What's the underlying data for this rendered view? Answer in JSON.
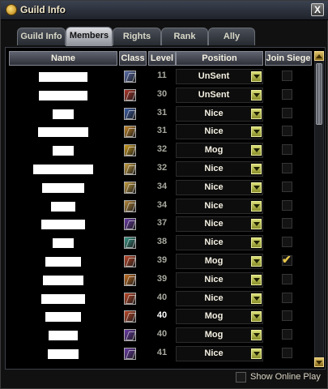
{
  "window": {
    "title": "Guild Info",
    "close_label": "X"
  },
  "tabs": [
    {
      "label": "Guild Info",
      "active": false
    },
    {
      "label": "Members",
      "active": true
    },
    {
      "label": "Rights",
      "active": false
    },
    {
      "label": "Rank",
      "active": false
    },
    {
      "label": "Ally",
      "active": false
    }
  ],
  "columns": {
    "name": "Name",
    "class": "Class",
    "level": "Level",
    "position": "Position",
    "join_siege": "Join Siege"
  },
  "members": [
    {
      "level": "11",
      "position": "UnSent",
      "class_icon": "mage-icon",
      "icon_color": "#5a6fb0",
      "join_siege": false,
      "level_highlight": false
    },
    {
      "level": "30",
      "position": "UnSent",
      "class_icon": "swirl-icon",
      "icon_color": "#b0352a",
      "join_siege": false,
      "level_highlight": false
    },
    {
      "level": "31",
      "position": "Nice",
      "class_icon": "shield-icon",
      "icon_color": "#3c5ea8",
      "join_siege": false,
      "level_highlight": false
    },
    {
      "level": "31",
      "position": "Nice",
      "class_icon": "warrior-icon",
      "icon_color": "#c98a2a",
      "join_siege": false,
      "level_highlight": false
    },
    {
      "level": "32",
      "position": "Mog",
      "class_icon": "flame-icon",
      "icon_color": "#d2a020",
      "join_siege": false,
      "level_highlight": false
    },
    {
      "level": "32",
      "position": "Nice",
      "class_icon": "fist-icon",
      "icon_color": "#c9a040",
      "join_siege": false,
      "level_highlight": false
    },
    {
      "level": "34",
      "position": "Nice",
      "class_icon": "fist-icon",
      "icon_color": "#c9a040",
      "join_siege": false,
      "level_highlight": false
    },
    {
      "level": "34",
      "position": "Nice",
      "class_icon": "scroll-icon",
      "icon_color": "#b88a3a",
      "join_siege": false,
      "level_highlight": false
    },
    {
      "level": "37",
      "position": "Nice",
      "class_icon": "blade-icon",
      "icon_color": "#6a3aa8",
      "join_siege": false,
      "level_highlight": false
    },
    {
      "level": "38",
      "position": "Nice",
      "class_icon": "runner-icon",
      "icon_color": "#3a9a8a",
      "join_siege": false,
      "level_highlight": false
    },
    {
      "level": "39",
      "position": "Mog",
      "class_icon": "strike-icon",
      "icon_color": "#c04828",
      "join_siege": true,
      "level_highlight": false
    },
    {
      "level": "39",
      "position": "Nice",
      "class_icon": "dancer-icon",
      "icon_color": "#c87020",
      "join_siege": false,
      "level_highlight": false
    },
    {
      "level": "40",
      "position": "Nice",
      "class_icon": "strike-icon",
      "icon_color": "#c04828",
      "join_siege": false,
      "level_highlight": false
    },
    {
      "level": "40",
      "position": "Mog",
      "class_icon": "strike-icon",
      "icon_color": "#c04828",
      "join_siege": false,
      "level_highlight": true
    },
    {
      "level": "40",
      "position": "Mog",
      "class_icon": "blade-icon",
      "icon_color": "#6a3aa8",
      "join_siege": false,
      "level_highlight": false
    },
    {
      "level": "41",
      "position": "Nice",
      "class_icon": "blade-icon",
      "icon_color": "#6a3aa8",
      "join_siege": false,
      "level_highlight": false
    }
  ],
  "footer": {
    "show_online_label": "Show Online Play",
    "show_online_checked": false
  }
}
